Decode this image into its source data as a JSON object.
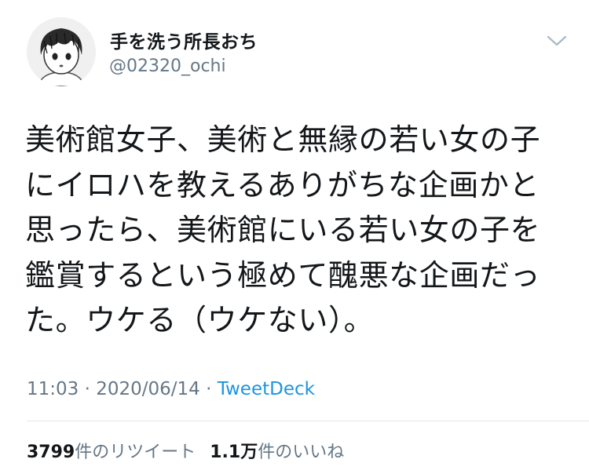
{
  "user": {
    "display_name": "手を洗う所長おち",
    "handle": "@02320_ochi"
  },
  "tweet": {
    "text": "美術館女子、美術と無縁の若い女の子にイロハを教えるありがちな企画かと思ったら、美術館にいる若い女の子を鑑賞するという極めて醜悪な企画だった。ウケる（ウケない）。",
    "time": "11:03",
    "separator": "·",
    "date": "2020/06/14",
    "source": "TweetDeck"
  },
  "stats": {
    "retweet_count": "3799",
    "retweet_label": "件のリツイート",
    "like_count": "1.1万",
    "like_label": "件のいいね"
  },
  "icons": {
    "avatar": "cartoon-avatar",
    "menu": "chevron-down-icon"
  }
}
